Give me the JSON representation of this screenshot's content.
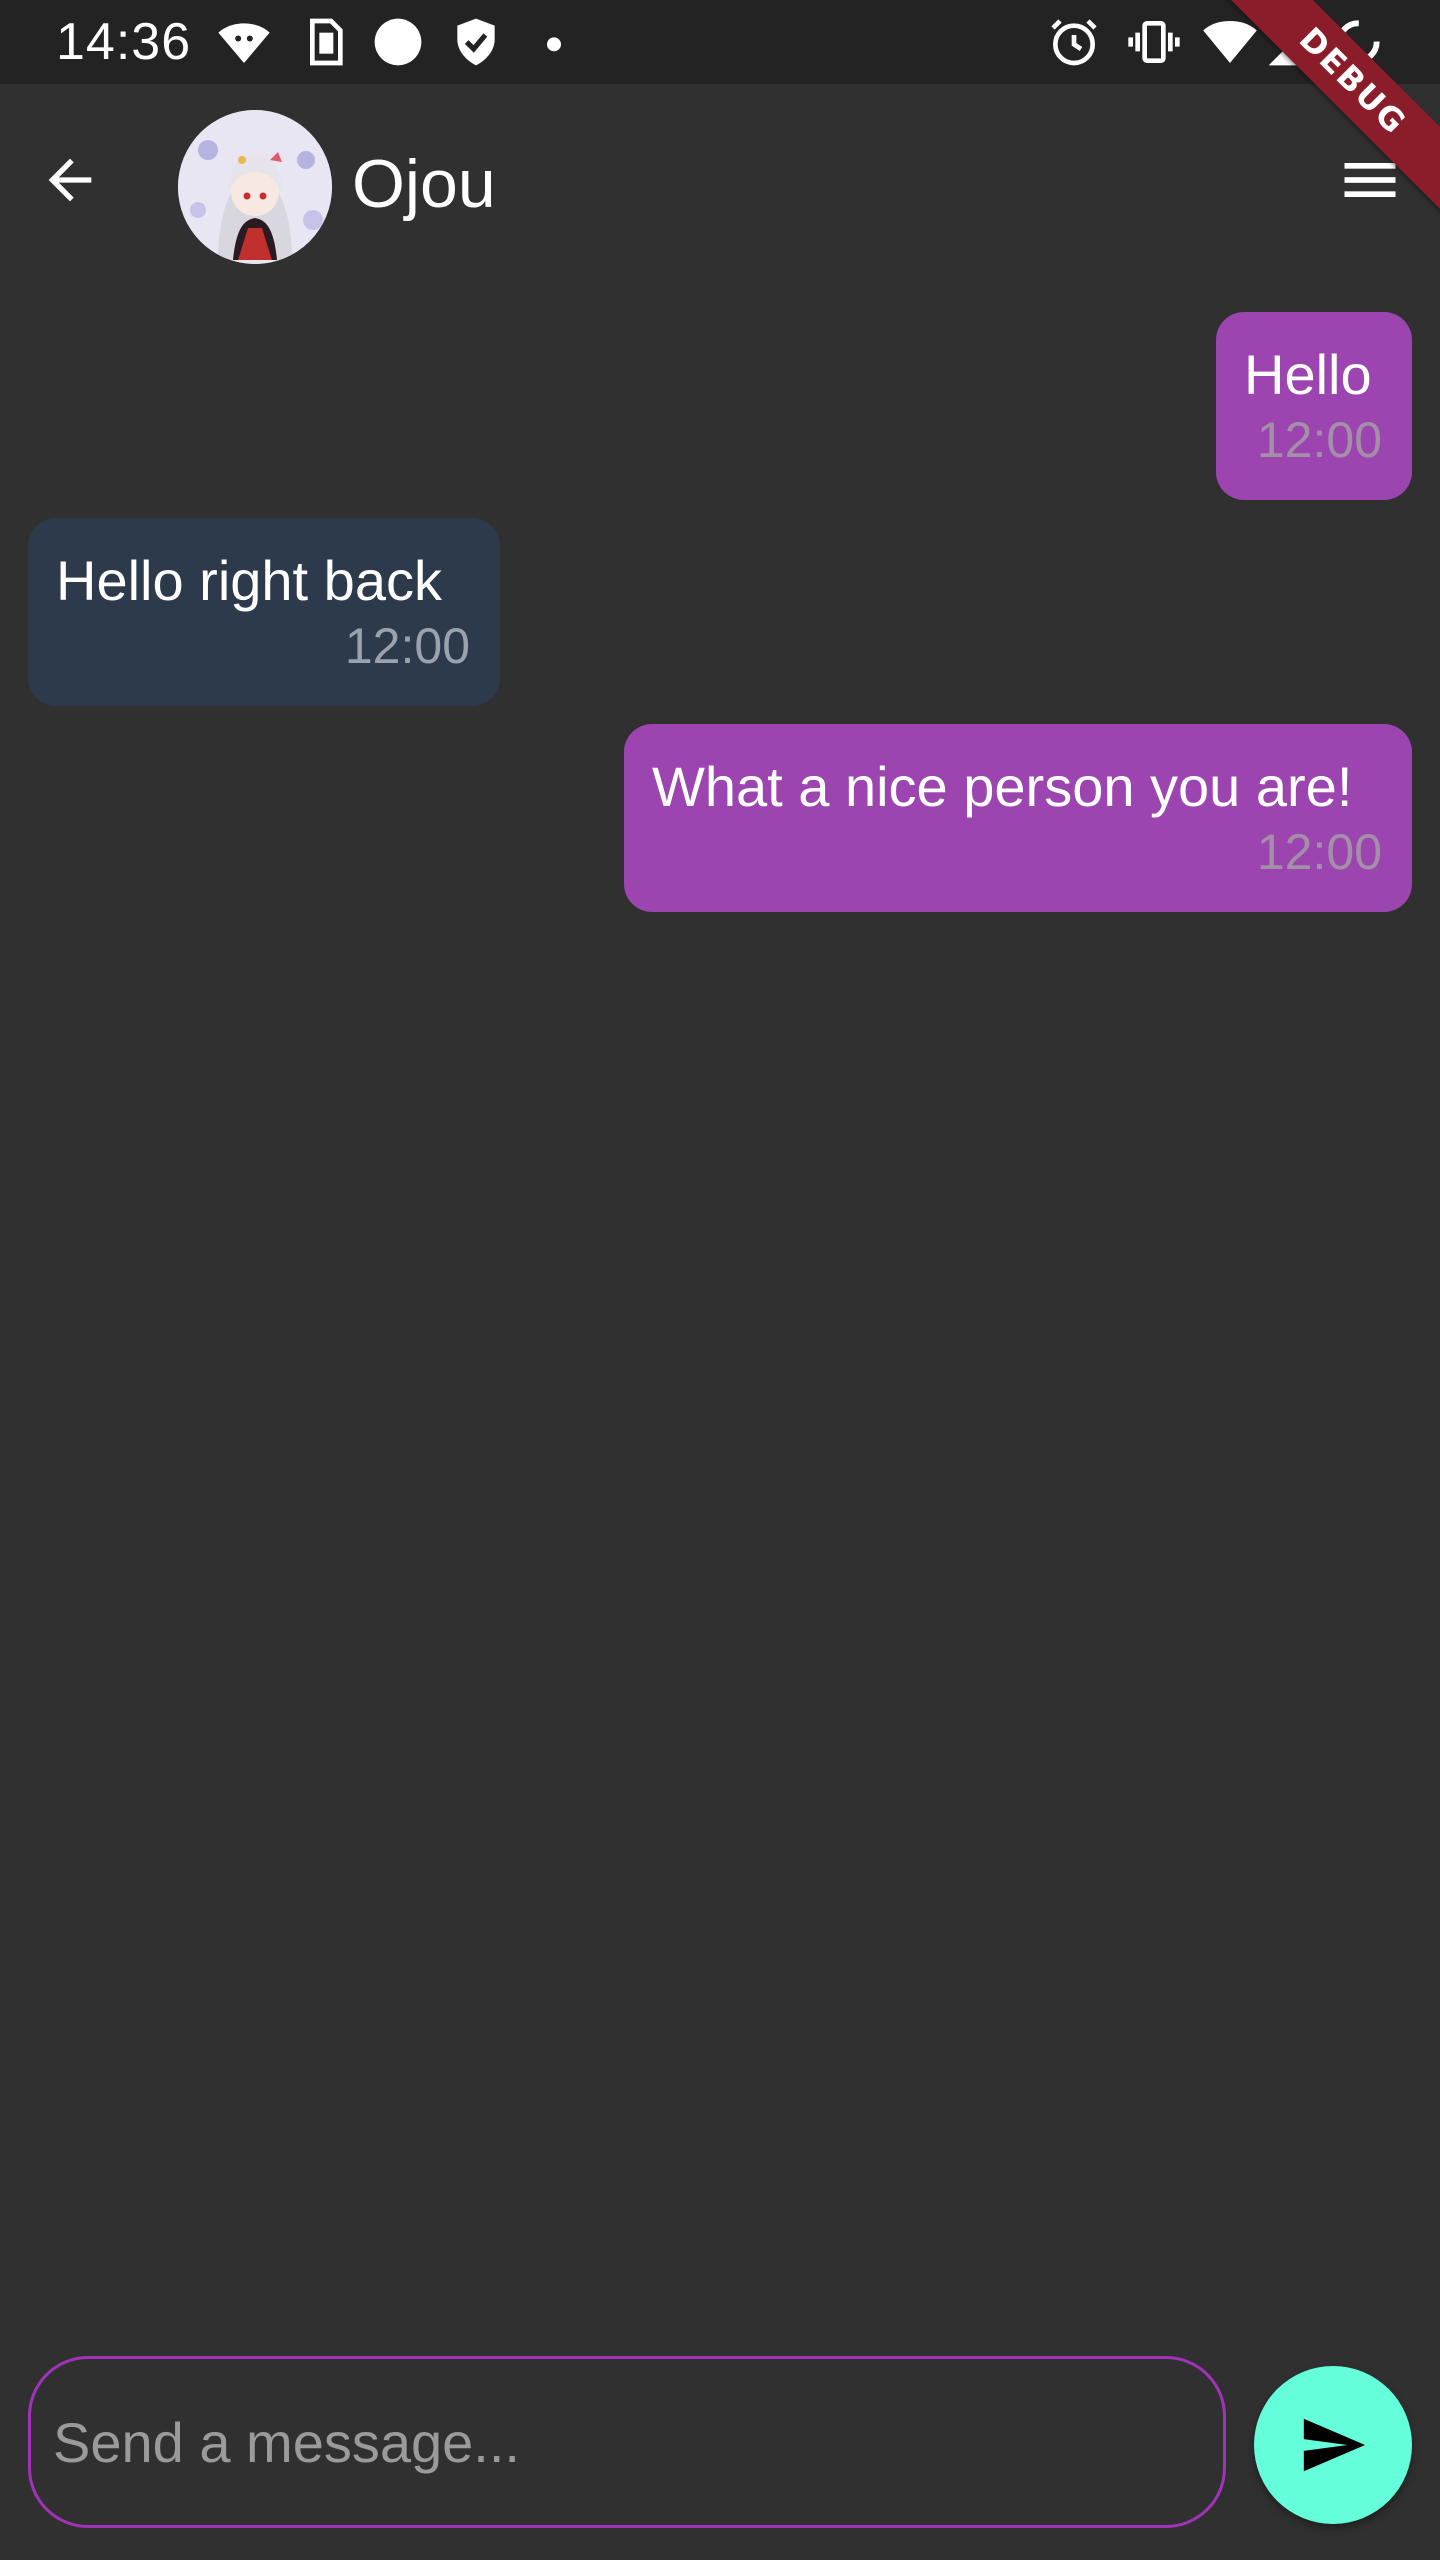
{
  "status_bar": {
    "time": "14:36",
    "left_icons": [
      "vpn-icon",
      "sim-card-icon",
      "circle-icon",
      "shield-check-icon",
      "dot-icon"
    ],
    "right_icons": [
      "alarm-icon",
      "vibrate-icon",
      "wifi-icon",
      "signal-icon",
      "loading-icon"
    ]
  },
  "debug_banner": "DEBUG",
  "app_bar": {
    "contact_name": "Ojou",
    "back_icon": "arrow-back-icon",
    "menu_icon": "menu-icon"
  },
  "messages": [
    {
      "direction": "outgoing",
      "text": "Hello",
      "time": "12:00"
    },
    {
      "direction": "incoming",
      "text": "Hello right back",
      "time": "12:00"
    },
    {
      "direction": "outgoing",
      "text": "What a nice person you are!",
      "time": "12:00"
    }
  ],
  "composer": {
    "placeholder": "Send a message...",
    "value": "",
    "send_icon": "send-icon"
  },
  "colors": {
    "background": "#303030",
    "status_bar": "#232323",
    "outgoing_bubble": "#9c45b0",
    "incoming_bubble": "#2c3a4c",
    "input_border": "#a033b8",
    "send_button": "#64ffda",
    "debug_ribbon": "#8b1d2a"
  }
}
